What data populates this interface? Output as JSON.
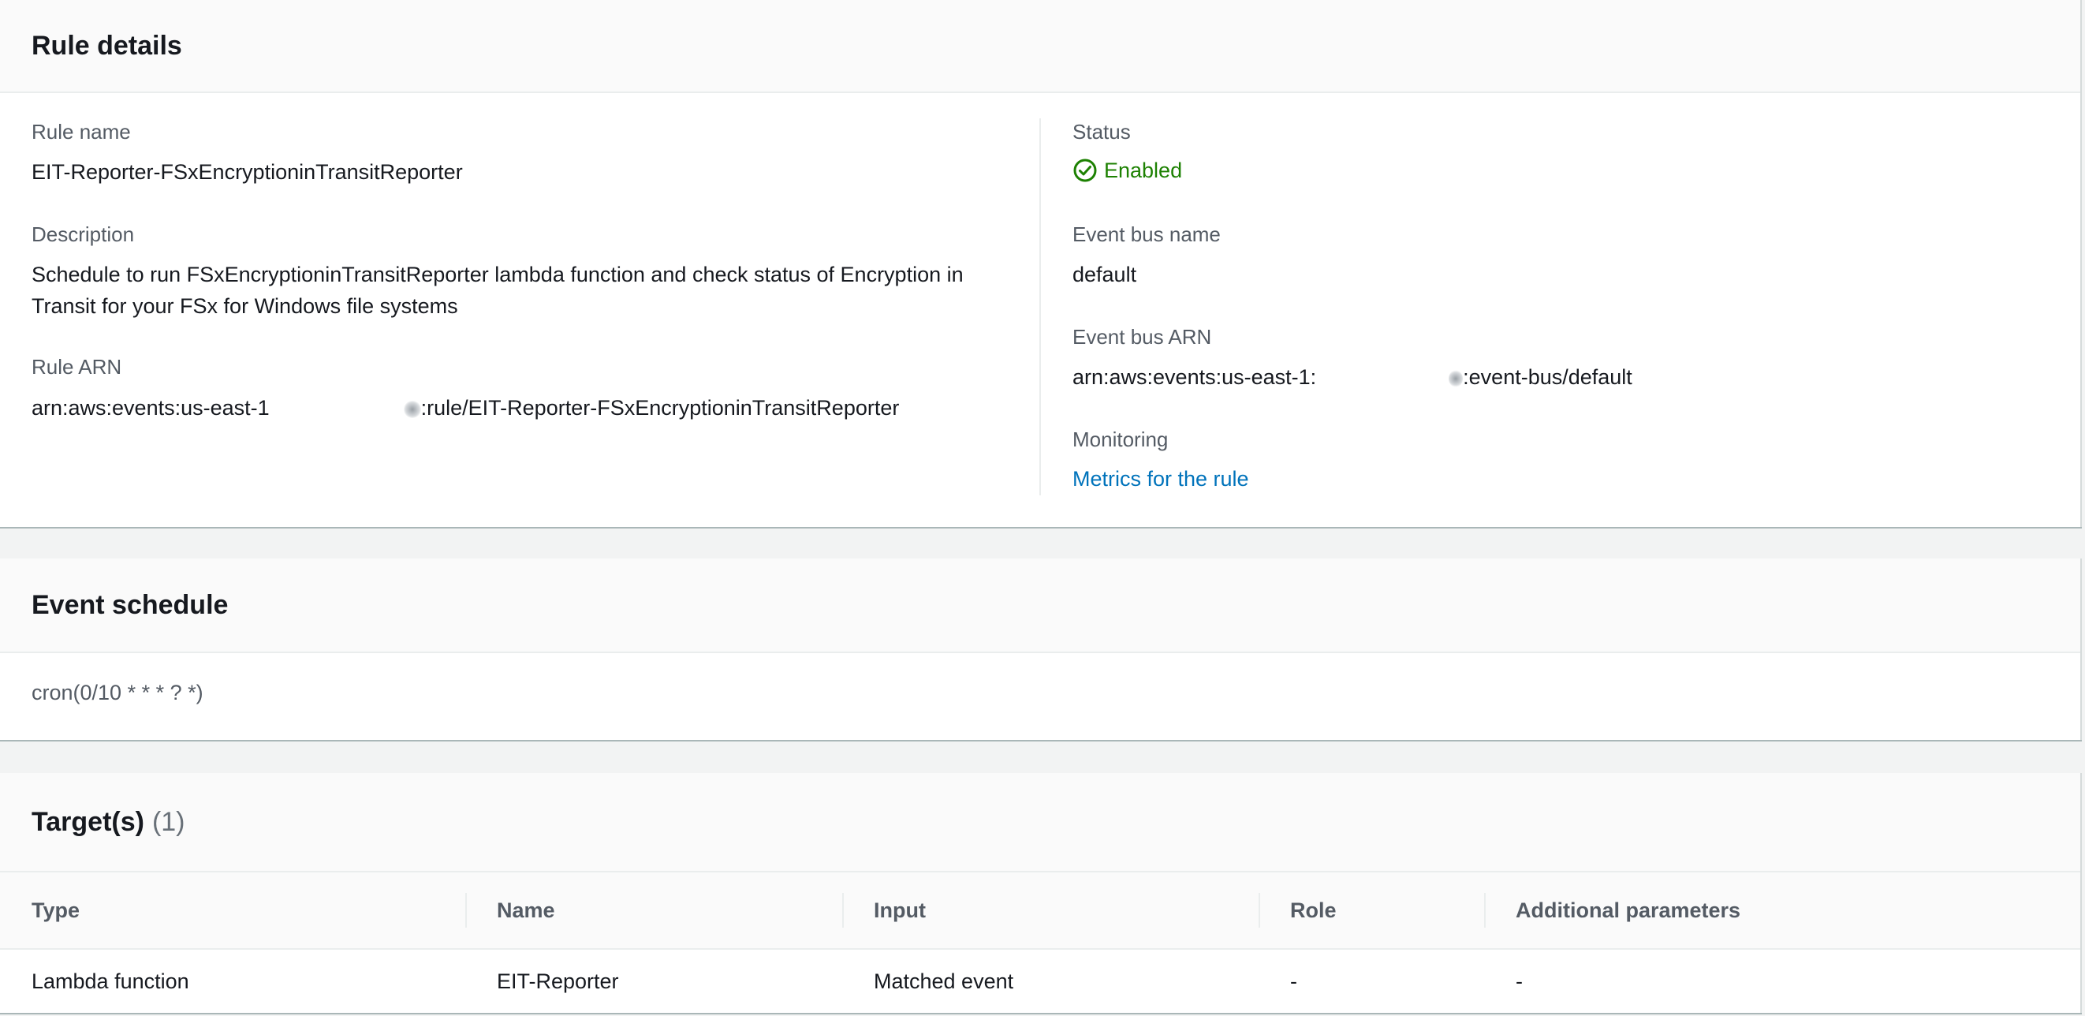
{
  "rule_details": {
    "title": "Rule details",
    "rule_name_label": "Rule name",
    "rule_name": "EIT-Reporter-FSxEncryptioninTransitReporter",
    "description_label": "Description",
    "description": "Schedule to run FSxEncryptioninTransitReporter lambda function and check status of Encryption in Transit for your FSx for Windows file systems",
    "rule_arn_label": "Rule ARN",
    "rule_arn_prefix": "arn:aws:events:us-east-1",
    "rule_arn_suffix": ":rule/EIT-Reporter-FSxEncryptioninTransitReporter",
    "status_label": "Status",
    "status": "Enabled",
    "event_bus_name_label": "Event bus name",
    "event_bus_name": "default",
    "event_bus_arn_label": "Event bus ARN",
    "event_bus_arn_prefix": "arn:aws:events:us-east-1:",
    "event_bus_arn_suffix": ":event-bus/default",
    "monitoring_label": "Monitoring",
    "monitoring_link": "Metrics for the rule"
  },
  "event_schedule": {
    "title": "Event schedule",
    "expression": "cron(0/10 * * * ? *)"
  },
  "targets": {
    "title": "Target(s)",
    "count": "(1)",
    "columns": [
      "Type",
      "Name",
      "Input",
      "Role",
      "Additional parameters"
    ],
    "rows": [
      [
        "Lambda function",
        "EIT-Reporter",
        "Matched event",
        "-",
        "-"
      ]
    ]
  },
  "colors": {
    "status_green": "#1d8102",
    "link_blue": "#0073bb"
  },
  "icons": {
    "status": "check-circle-icon"
  }
}
